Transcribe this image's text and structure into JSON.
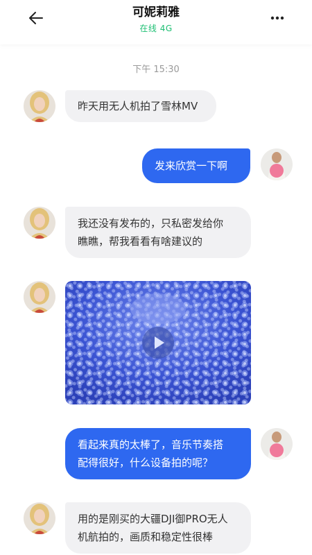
{
  "header": {
    "title": "可妮莉雅",
    "status": "在线 4G",
    "back_icon": "arrow-left-icon",
    "more_icon": "ellipsis-icon"
  },
  "timestamp": "下午 15:30",
  "messages": [
    {
      "side": "in",
      "text": "昨天用无人机拍了雪林MV"
    },
    {
      "side": "out",
      "text": "发来欣赏一下啊"
    },
    {
      "side": "in",
      "lines": [
        "我还没有发布的，只私密发给你",
        "瞧瞧，帮我看看有啥建议的"
      ]
    },
    {
      "side": "in",
      "type": "video",
      "thumbnail": "snowy-forest-aerial",
      "icon": "play-icon"
    },
    {
      "side": "out",
      "lines": [
        "看起来真的太棒了，音乐节奏搭",
        "配得很好，什么设备拍的呢？"
      ]
    },
    {
      "side": "in",
      "lines": [
        "用的是刚买的大疆DJI御PRO无人",
        "机航拍的，画质和稳定性很棒"
      ]
    }
  ],
  "colors": {
    "accent": "#2e68f0",
    "online": "#1dbf73",
    "incoming_bubble": "#f1f1f3"
  }
}
